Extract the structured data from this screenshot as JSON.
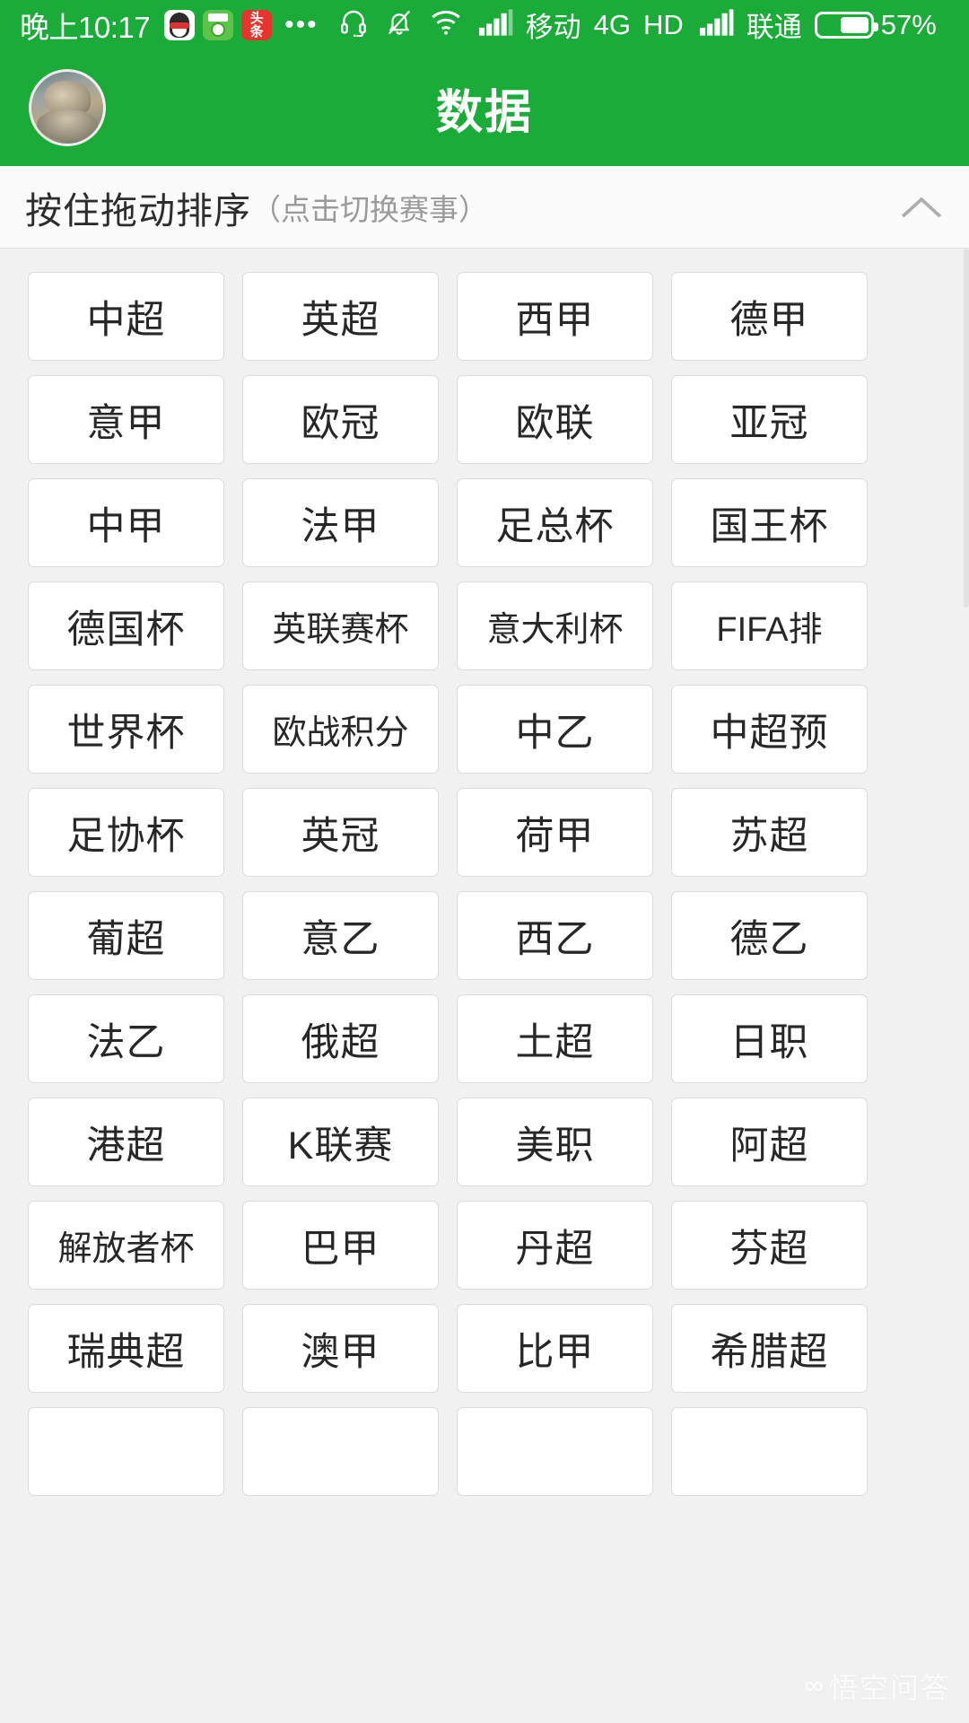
{
  "statusbar": {
    "time": "晚上10:17",
    "app_icons": [
      {
        "name": "qq-icon",
        "label": "QQ"
      },
      {
        "name": "football-app-icon",
        "label": "球"
      },
      {
        "name": "toutiao-icon",
        "label": "头条"
      }
    ],
    "overflow_dots": "•••",
    "icons": [
      "headset-icon",
      "bell-muted-icon",
      "wifi-icon",
      "signal-bars-icon"
    ],
    "carrier_primary": "移动",
    "network_type": "4G",
    "hd_label": "HD",
    "carrier_secondary": "联通",
    "battery_percent": "57%",
    "battery_level": 57
  },
  "appbar": {
    "title": "数据",
    "avatar_name": "user-avatar"
  },
  "section": {
    "main_label": "按住拖动排序",
    "sub_label": "（点击切换赛事）",
    "collapse_icon": "chevron-up-icon"
  },
  "grid": {
    "columns": 4,
    "tiles": [
      "中超",
      "英超",
      "西甲",
      "德甲",
      "意甲",
      "欧冠",
      "欧联",
      "亚冠",
      "中甲",
      "法甲",
      "足总杯",
      "国王杯",
      "德国杯",
      "英联赛杯",
      "意大利杯",
      "FIFA排",
      "世界杯",
      "欧战积分",
      "中乙",
      "中超预",
      "足协杯",
      "英冠",
      "荷甲",
      "苏超",
      "葡超",
      "意乙",
      "西乙",
      "德乙",
      "法乙",
      "俄超",
      "土超",
      "日职",
      "港超",
      "K联赛",
      "美职",
      "阿超",
      "解放者杯",
      "巴甲",
      "丹超",
      "芬超",
      "瑞典超",
      "澳甲",
      "比甲",
      "希腊超",
      "",
      "",
      "",
      ""
    ]
  },
  "watermark": {
    "logo": "∞",
    "text": "悟空问答"
  },
  "colors": {
    "brand_green": "#1aab39",
    "page_background": "#f1f1f1",
    "tile_background": "#ffffff",
    "tile_border": "#dcdcdc",
    "text_primary": "#272727",
    "text_muted": "#9a9a9a"
  }
}
